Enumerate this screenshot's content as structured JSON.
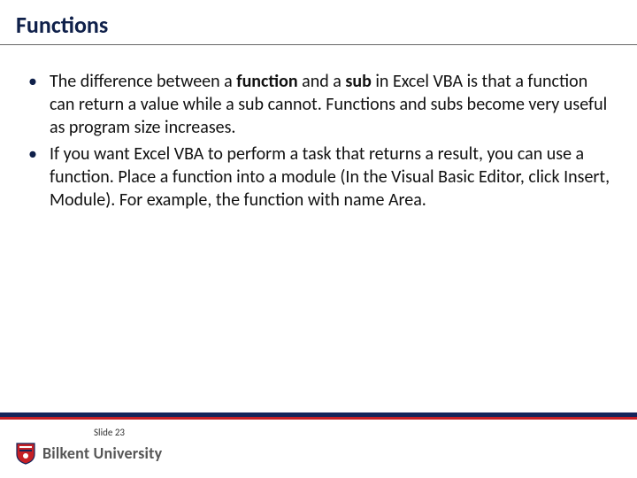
{
  "title": "Functions",
  "bullets": [
    {
      "segments": [
        {
          "t": "The difference between a ",
          "b": false
        },
        {
          "t": "function",
          "b": true
        },
        {
          "t": " and a ",
          "b": false
        },
        {
          "t": "sub",
          "b": true
        },
        {
          "t": " in Excel VBA is that a function can return a value while a sub cannot. Functions and subs become very useful as program size increases.",
          "b": false
        }
      ]
    },
    {
      "segments": [
        {
          "t": "If you want Excel VBA to perform a task that returns a result, you can use a function. Place a function into a module (In the Visual Basic Editor, click Insert, Module). For example, the function with name Area.",
          "b": false
        }
      ]
    }
  ],
  "slide_label": "Slide 23",
  "university": "Bilkent University",
  "crest_colors": {
    "shield": "#c62026",
    "border": "#14255b",
    "accent": "#ffffff"
  }
}
